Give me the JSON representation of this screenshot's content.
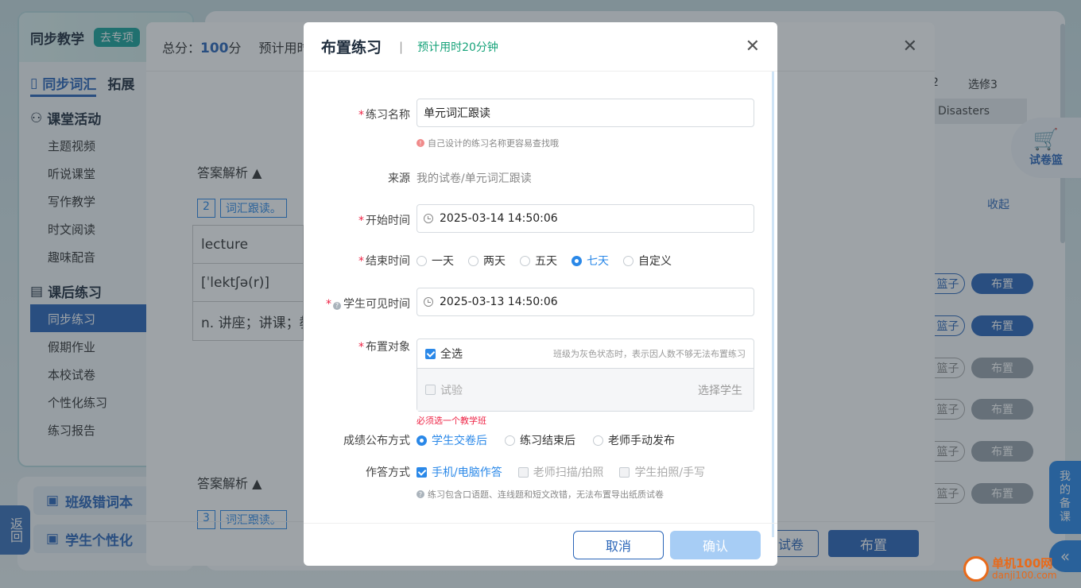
{
  "background": {
    "left_panel": {
      "title": "同步教学",
      "badge": "去专项",
      "tab_active": "同步词汇",
      "tab_other": "拓展",
      "section1": "课堂活动",
      "section1_items": [
        "主题视频",
        "听说课堂",
        "写作教学",
        "时文阅读",
        "趣味配音"
      ],
      "section2": "课后练习",
      "section2_items": [
        "同步练习",
        "假期作业",
        "本校试卷",
        "个性化练习",
        "练习报告"
      ],
      "extra1": "班级错词本",
      "extra2": "学生个性化",
      "back": "返回"
    },
    "right_page": {
      "num2": "2",
      "elective": "选修3",
      "disasters": "Disasters",
      "cart": "试卷篮",
      "collapse": "收起",
      "basket_btn": "篮子",
      "assign_btn": "布置",
      "my_prep": "我的备课",
      "fold": "«"
    },
    "mid_modal": {
      "score_label": "总分：",
      "score_value": "100",
      "score_unit": "分",
      "time_label": "预计用时",
      "analysis": "答案解析 ▲",
      "tag_num1": "2",
      "tag_text1": "词汇跟读。",
      "tag_num2": "3",
      "tag_text2": "词汇跟读。",
      "word": "lecture",
      "phonetic": "[ˈlektʃə(r)]",
      "meaning": "n. 讲座；讲课；教",
      "btn_paper": "试卷",
      "btn_assign": "布置"
    }
  },
  "dialog": {
    "title": "布置练习",
    "separator": "|",
    "estimated": "预计用时20分钟",
    "close": "✕",
    "name_label": "练习名称",
    "name_value": "单元词汇跟读",
    "name_hint": "自己设计的练习名称更容易查找哦",
    "source_label": "来源",
    "source_value": "我的试卷/单元词汇跟读",
    "start_label": "开始时间",
    "start_value": "2025-03-14 14:50:06",
    "end_label": "结束时间",
    "end_options": [
      "一天",
      "两天",
      "五天",
      "七天",
      "自定义"
    ],
    "end_selected": "七天",
    "visible_label": "学生可见时间",
    "visible_value": "2025-03-13 14:50:06",
    "target_label": "布置对象",
    "select_all": "全选",
    "target_tip": "班级为灰色状态时，表示因人数不够无法布置练习",
    "class_name": "试验",
    "choose_students": "选择学生",
    "target_error": "必须选一个教学班",
    "publish_label": "成绩公布方式",
    "publish_options": [
      "学生交卷后",
      "练习结束后",
      "老师手动发布"
    ],
    "publish_selected": "学生交卷后",
    "answer_label": "作答方式",
    "answer_options": [
      "手机/电脑作答",
      "老师扫描/拍照",
      "学生拍照/手写"
    ],
    "answer_hint": "练习包含口语题、连线题和短文改错，无法布置导出纸质试卷",
    "cancel": "取消",
    "confirm": "确认"
  },
  "watermark": {
    "text": "单机100网",
    "url": "danji100.com"
  },
  "colors": {
    "primary": "#2a65b8",
    "accent": "#2a88e8",
    "green": "#17a37a",
    "error": "#e24"
  }
}
